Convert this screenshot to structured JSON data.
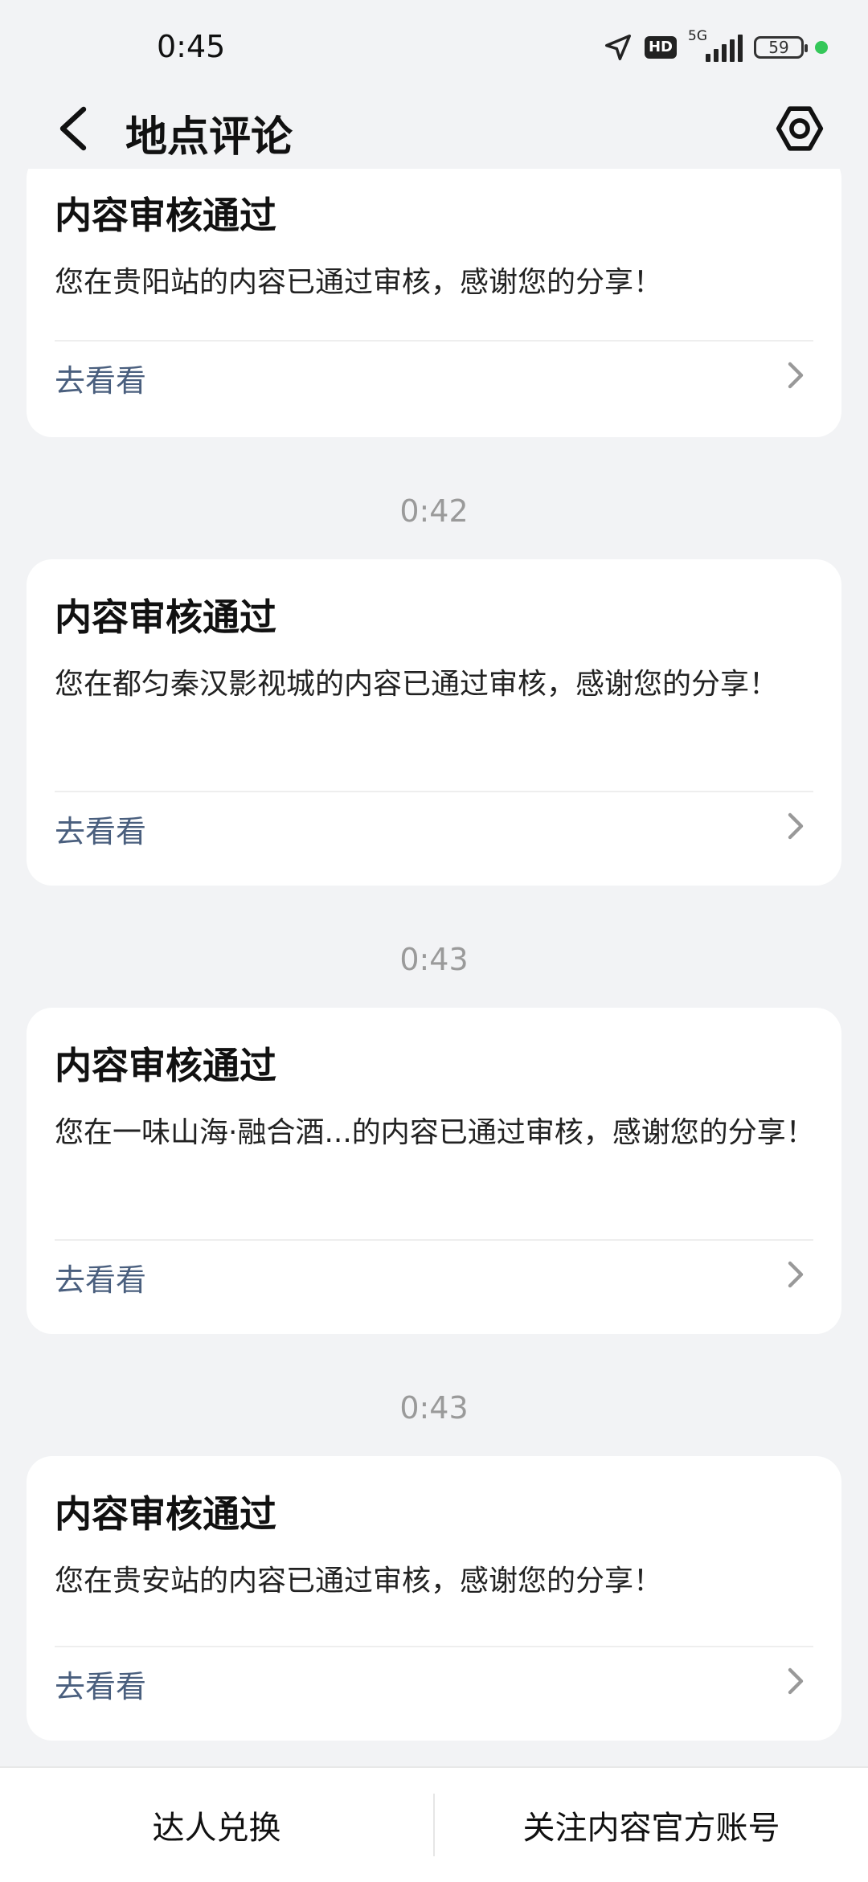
{
  "status_bar": {
    "time": "0:45",
    "hd_label": "HD",
    "network_label": "5G",
    "battery": "59"
  },
  "header": {
    "title": "地点评论"
  },
  "messages": [
    {
      "title": "内容审核通过",
      "body": "您在贵阳站的内容已通过审核，感谢您的分享！",
      "link": "去看看"
    },
    {
      "time": "0:42",
      "title": "内容审核通过",
      "body": "您在都匀秦汉影视城的内容已通过审核，感谢您的分享！",
      "link": "去看看"
    },
    {
      "time": "0:43",
      "title": "内容审核通过",
      "body": "您在一味山海·融合酒...的内容已通过审核，感谢您的分享！",
      "link": "去看看"
    },
    {
      "time": "0:43",
      "title": "内容审核通过",
      "body": "您在贵安站的内容已通过审核，感谢您的分享！",
      "link": "去看看"
    }
  ],
  "bottom_bar": {
    "left_label": "达人兑换",
    "right_label": "关注内容官方账号"
  },
  "icons": {
    "back": "back-arrow-icon",
    "settings": "hexagon-settings-icon",
    "chevron": "chevron-right-icon",
    "location": "location-arrow-icon"
  },
  "colors": {
    "background": "#f2f3f5",
    "card": "#ffffff",
    "link": "#4a5f7e",
    "time_label": "#9a9a9a",
    "status_dot": "#34c759"
  }
}
